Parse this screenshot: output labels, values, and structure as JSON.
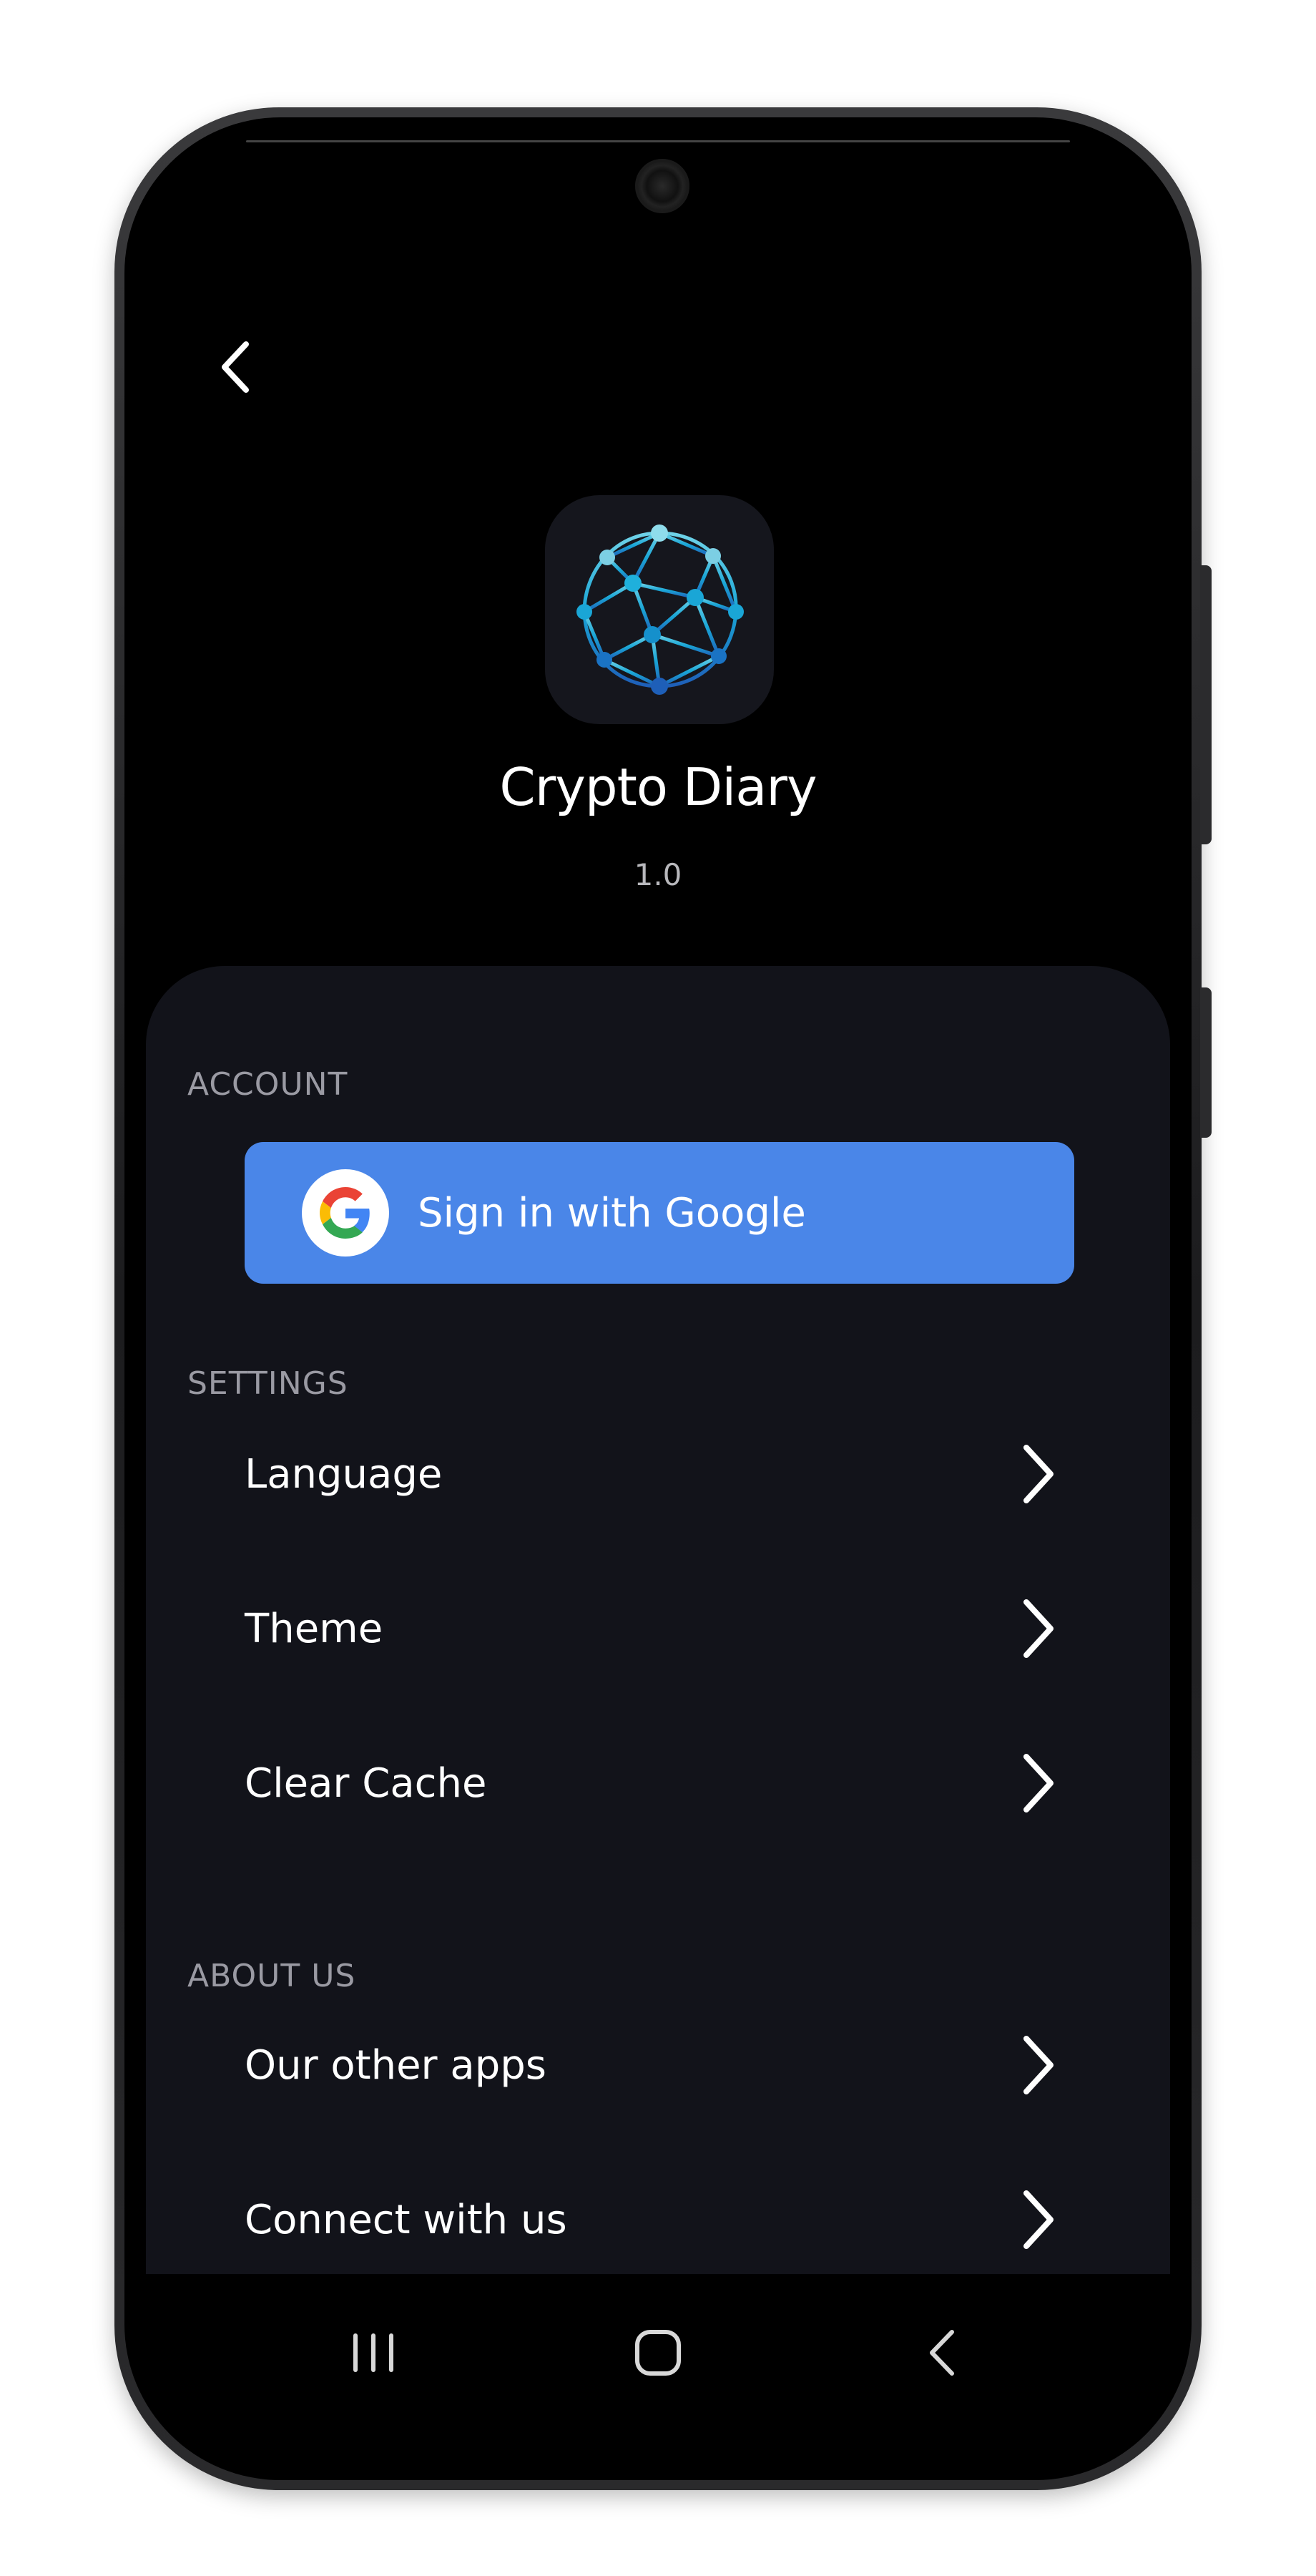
{
  "app": {
    "name": "Crypto Diary",
    "version": "1.0"
  },
  "sections": {
    "account": {
      "label": "ACCOUNT",
      "google_button_label": "Sign in with Google"
    },
    "settings": {
      "label": "SETTINGS",
      "items": [
        {
          "label": "Language"
        },
        {
          "label": "Theme"
        },
        {
          "label": "Clear Cache"
        }
      ]
    },
    "about": {
      "label": "ABOUT US",
      "items": [
        {
          "label": "Our other apps"
        },
        {
          "label": "Connect with us"
        }
      ]
    }
  },
  "icons": {
    "back": "back-arrow-icon",
    "chevron": "chevron-right-icon",
    "google": "google-logo-icon",
    "app_logo": "network-globe-icon",
    "nav_recents": "recents-icon",
    "nav_home": "home-icon",
    "nav_back": "nav-back-icon"
  },
  "colors": {
    "background": "#000000",
    "sheet": "#12131a",
    "google_button": "#4a86e8",
    "section_label": "#9a9aa3",
    "text": "#ffffff"
  }
}
